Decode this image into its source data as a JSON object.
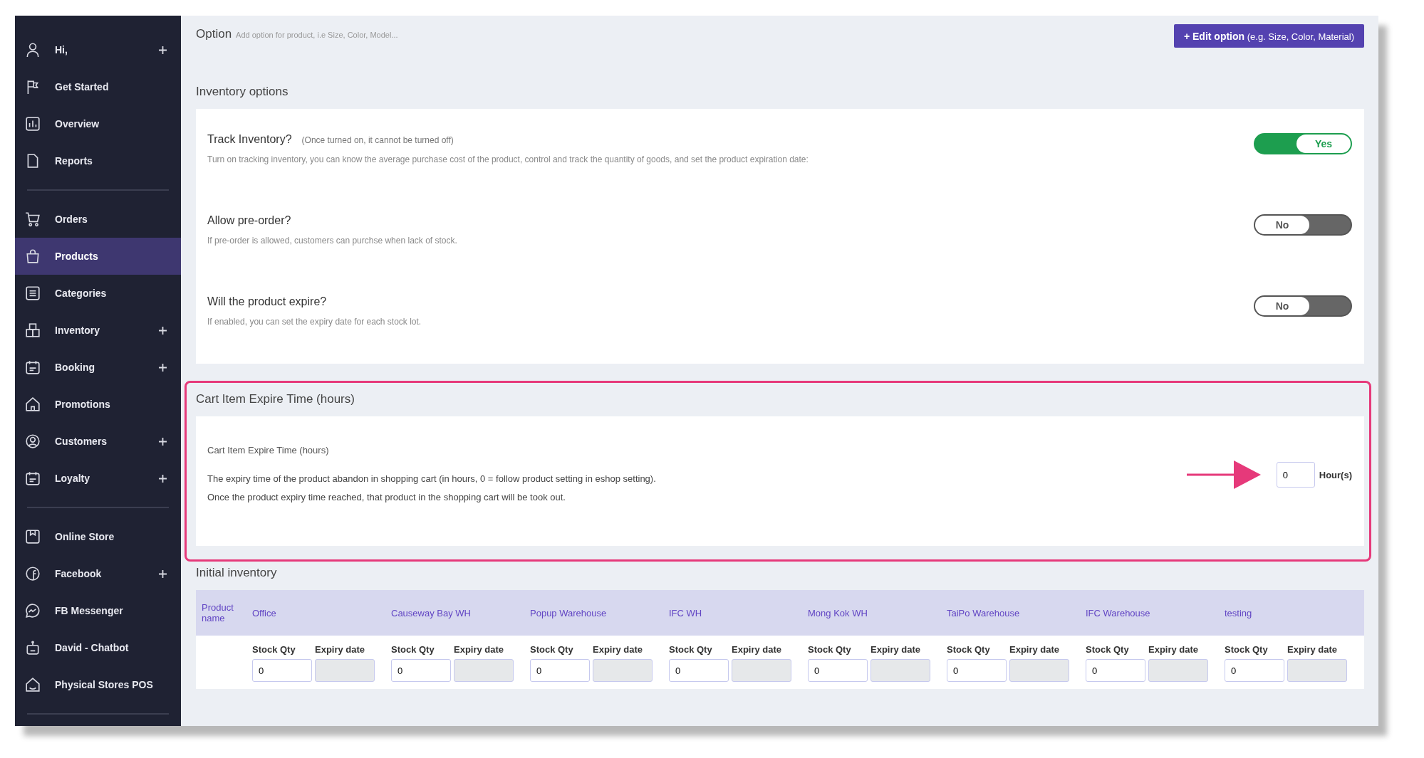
{
  "sidebar": {
    "groups": [
      [
        {
          "label": "Hi,",
          "expandable": true,
          "selected": false
        },
        {
          "label": "Get Started",
          "expandable": false,
          "selected": false
        },
        {
          "label": "Overview",
          "expandable": false,
          "selected": false
        },
        {
          "label": "Reports",
          "expandable": false,
          "selected": false
        }
      ],
      [
        {
          "label": "Orders",
          "expandable": false,
          "selected": false
        },
        {
          "label": "Products",
          "expandable": false,
          "selected": true
        },
        {
          "label": "Categories",
          "expandable": false,
          "selected": false
        },
        {
          "label": "Inventory",
          "expandable": true,
          "selected": false
        },
        {
          "label": "Booking",
          "expandable": true,
          "selected": false
        },
        {
          "label": "Promotions",
          "expandable": false,
          "selected": false
        },
        {
          "label": "Customers",
          "expandable": true,
          "selected": false
        },
        {
          "label": "Loyalty",
          "expandable": true,
          "selected": false
        }
      ],
      [
        {
          "label": "Online Store",
          "expandable": false,
          "selected": false
        },
        {
          "label": "Facebook",
          "expandable": true,
          "selected": false
        },
        {
          "label": "FB Messenger",
          "expandable": false,
          "selected": false
        },
        {
          "label": "David - Chatbot",
          "expandable": false,
          "selected": false
        },
        {
          "label": "Physical Stores POS",
          "expandable": false,
          "selected": false
        }
      ]
    ]
  },
  "option": {
    "title": "Option",
    "hint": "Add option for product, i.e Size, Color, Model...",
    "button": "+ Edit option",
    "button_hint": "(e.g. Size, Color, Material)"
  },
  "inventory_options": {
    "title": "Inventory options",
    "toggles": [
      {
        "label": "Track Inventory?",
        "note": "(Once turned on, it cannot be turned off)",
        "description": "Turn on tracking inventory, you can know the average purchase cost of the product, control and track the quantity of goods, and set the product expiration date:",
        "on": true,
        "state_text": "Yes"
      },
      {
        "label": "Allow pre-order?",
        "description": "If pre-order is allowed, customers can purchse when lack of stock.",
        "on": false,
        "state_text": "No"
      },
      {
        "label": "Will the product expire?",
        "description": "If enabled, you can set the expiry date for each stock lot.",
        "on": false,
        "state_text": "No"
      }
    ]
  },
  "cart_expire": {
    "title": "Cart Item Expire Time (hours)",
    "label": "Cart Item Expire Time (hours)",
    "description": [
      "The expiry time of the product abandon in shopping cart (in hours, 0 = follow product setting in eshop setting).",
      "Once the product expiry time reached, that product in the shopping cart will be took out."
    ],
    "value": "0",
    "unit": "Hour(s)",
    "highlighted": true
  },
  "initial_inventory": {
    "title": "Initial inventory",
    "product_column": "Product name",
    "warehouses": [
      {
        "name": "Office",
        "stock_label": "Stock Qty",
        "expiry_label": "Expiry date",
        "stock_qty": "0",
        "expiry_disabled": true
      },
      {
        "name": "Causeway Bay WH",
        "stock_label": "Stock Qty",
        "expiry_label": "Expiry date",
        "stock_qty": "0",
        "expiry_disabled": true
      },
      {
        "name": "Popup Warehouse",
        "stock_label": "Stock Qty",
        "expiry_label": "Expiry date",
        "stock_qty": "0",
        "expiry_disabled": true
      },
      {
        "name": "IFC WH",
        "stock_label": "Stock Qty",
        "expiry_label": "Expiry date",
        "stock_qty": "0",
        "expiry_disabled": true
      },
      {
        "name": "Mong Kok WH",
        "stock_label": "Stock Qty",
        "expiry_label": "Expiry date",
        "stock_qty": "0",
        "expiry_disabled": true
      },
      {
        "name": "TaiPo Warehouse",
        "stock_label": "Stock Qty",
        "expiry_label": "Expiry date",
        "stock_qty": "0",
        "expiry_disabled": true
      },
      {
        "name": "IFC Warehouse",
        "stock_label": "Stock Qty",
        "expiry_label": "Expiry date",
        "stock_qty": "0",
        "expiry_disabled": true
      },
      {
        "name": "testing",
        "stock_label": "Stock Qty",
        "expiry_label": "Expiry date",
        "stock_qty": "0",
        "expiry_disabled": true
      }
    ]
  }
}
